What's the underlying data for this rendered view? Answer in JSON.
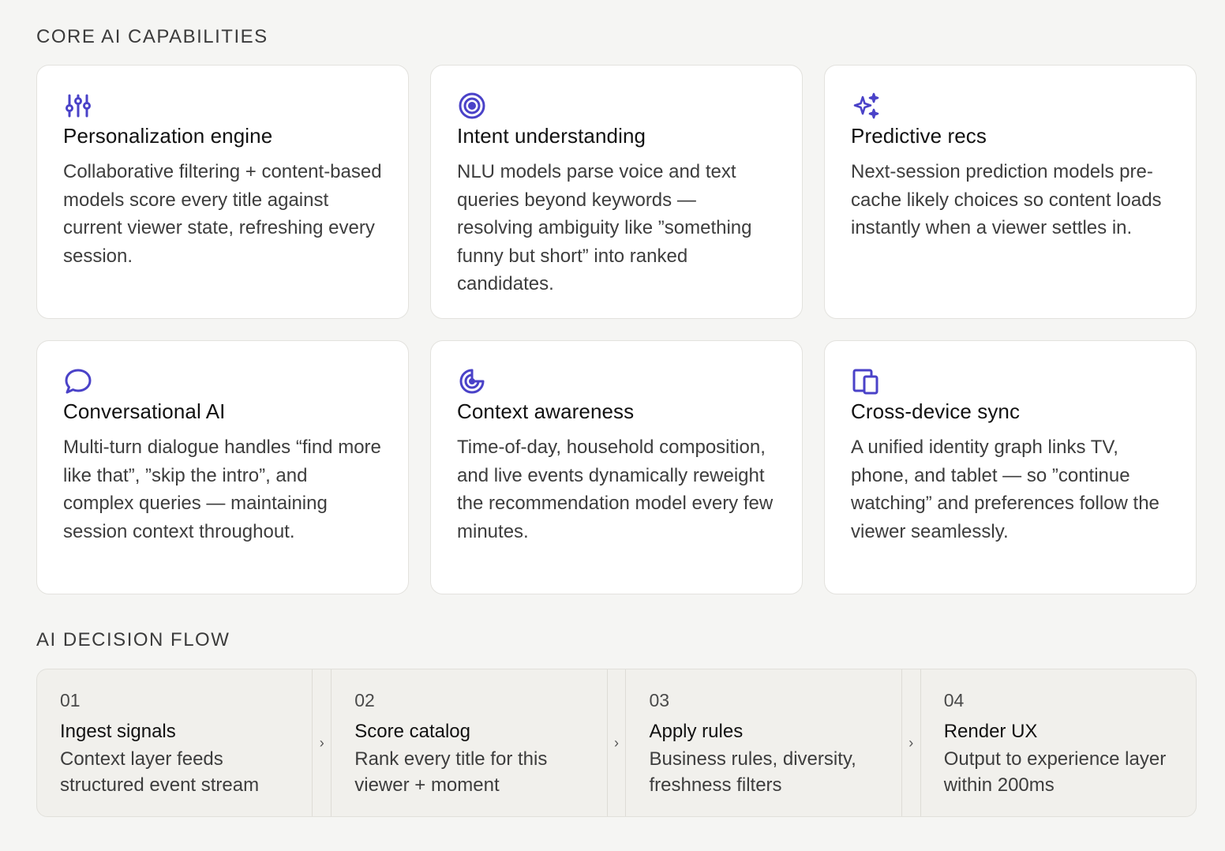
{
  "sections": {
    "capabilities_title": "CORE AI CAPABILITIES",
    "flow_title": "AI DECISION FLOW"
  },
  "accent_color": "#4a42c8",
  "cards": [
    {
      "icon": "sliders-icon",
      "title": "Personalization engine",
      "desc": "Collaborative filtering + content-based models score every title against current viewer state, refreshing every session."
    },
    {
      "icon": "target-icon",
      "title": "Intent understanding",
      "desc": "NLU models parse voice and text queries beyond keywords — resolving ambiguity like ”something funny but short” into ranked candidates."
    },
    {
      "icon": "sparkles-icon",
      "title": "Predictive recs",
      "desc": "Next-session prediction models pre-cache likely choices so content loads instantly when a viewer settles in."
    },
    {
      "icon": "chat-bubble-icon",
      "title": "Conversational AI",
      "desc": "Multi-turn dialogue handles “find more like that”, ”skip the intro”, and complex queries — maintaining session context throughout."
    },
    {
      "icon": "radar-icon",
      "title": "Context awareness",
      "desc": "Time-of-day, household composition, and live events dynamically reweight the recommendation model every few minutes."
    },
    {
      "icon": "devices-icon",
      "title": "Cross-device sync",
      "desc": "A unified identity graph links TV, phone, and tablet — so ”continue watching” and preferences follow the viewer seamlessly."
    }
  ],
  "flow": [
    {
      "num": "01",
      "title": "Ingest signals",
      "desc": "Context layer feeds structured event stream"
    },
    {
      "num": "02",
      "title": "Score catalog",
      "desc": "Rank every title for this viewer + moment"
    },
    {
      "num": "03",
      "title": "Apply rules",
      "desc": "Business rules, diversity, freshness filters"
    },
    {
      "num": "04",
      "title": "Render UX",
      "desc": "Output to experience layer within 200ms"
    }
  ],
  "separator_glyph": "›"
}
